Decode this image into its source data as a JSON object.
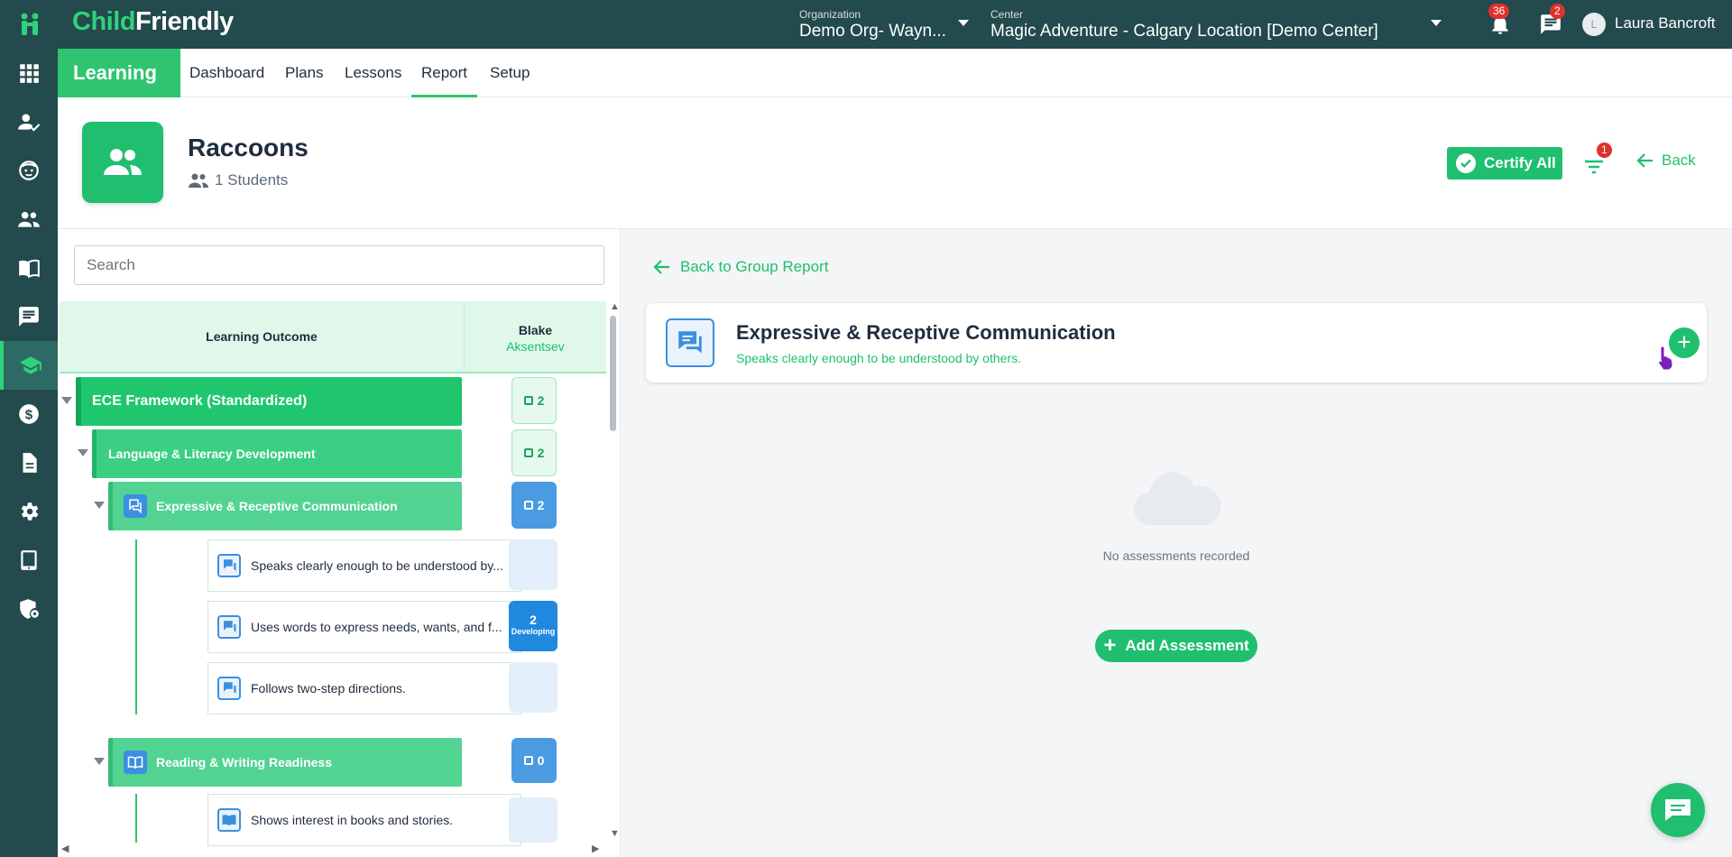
{
  "topbar": {
    "logo_part1": "Child",
    "logo_part2": "Friendly",
    "org_caption": "Organization",
    "org_value": "Demo Org- Wayn...",
    "center_caption": "Center",
    "center_value": "Magic Adventure - Calgary Location [Demo Center]",
    "notif_count": "36",
    "msg_count": "2",
    "avatar_initial": "L",
    "user_name": "Laura Bancroft"
  },
  "rail": {
    "icons": [
      "apps-icon",
      "attendance-icon",
      "child-icon",
      "staff-icon",
      "library-icon",
      "messages-icon",
      "learning-icon",
      "billing-icon",
      "documents-icon",
      "settings-icon",
      "tablet-icon",
      "security-icon"
    ],
    "active": "learning-icon"
  },
  "modnav": {
    "module": "Learning",
    "tabs": [
      "Dashboard",
      "Plans",
      "Lessons",
      "Report",
      "Setup"
    ],
    "active_tab": "Report"
  },
  "header": {
    "group_name": "Raccoons",
    "students": "1 Students",
    "certify_label": "Certify All",
    "filter_count": "1",
    "back_label": "Back"
  },
  "left": {
    "search_placeholder": "Search",
    "col_outcome": "Learning Outcome",
    "student_first": "Blake",
    "student_last": "Aksentsev",
    "rows": [
      {
        "label": "ECE Framework (Standardized)",
        "count": "2"
      },
      {
        "label": "Language & Literacy Development",
        "count": "2"
      },
      {
        "label": "Expressive & Receptive Communication",
        "count": "2"
      },
      {
        "label": "Speaks clearly enough to be understood by..."
      },
      {
        "label": "Uses words to express needs, wants, and f...",
        "count": "2",
        "status": "Developing"
      },
      {
        "label": "Follows two-step directions."
      },
      {
        "label": "Reading & Writing Readiness",
        "count": "0"
      },
      {
        "label": "Shows interest in books and stories."
      }
    ]
  },
  "right": {
    "back_to_group": "Back to Group Report",
    "card_title": "Expressive & Receptive Communication",
    "card_subtitle": "Speaks clearly enough to be understood by others.",
    "empty_text": "No assessments recorded",
    "add_label": "Add Assessment"
  },
  "colors": {
    "brand_green": "#1fbf6f",
    "topbar": "#234a4c",
    "accent_blue": "#3b8fe0"
  }
}
